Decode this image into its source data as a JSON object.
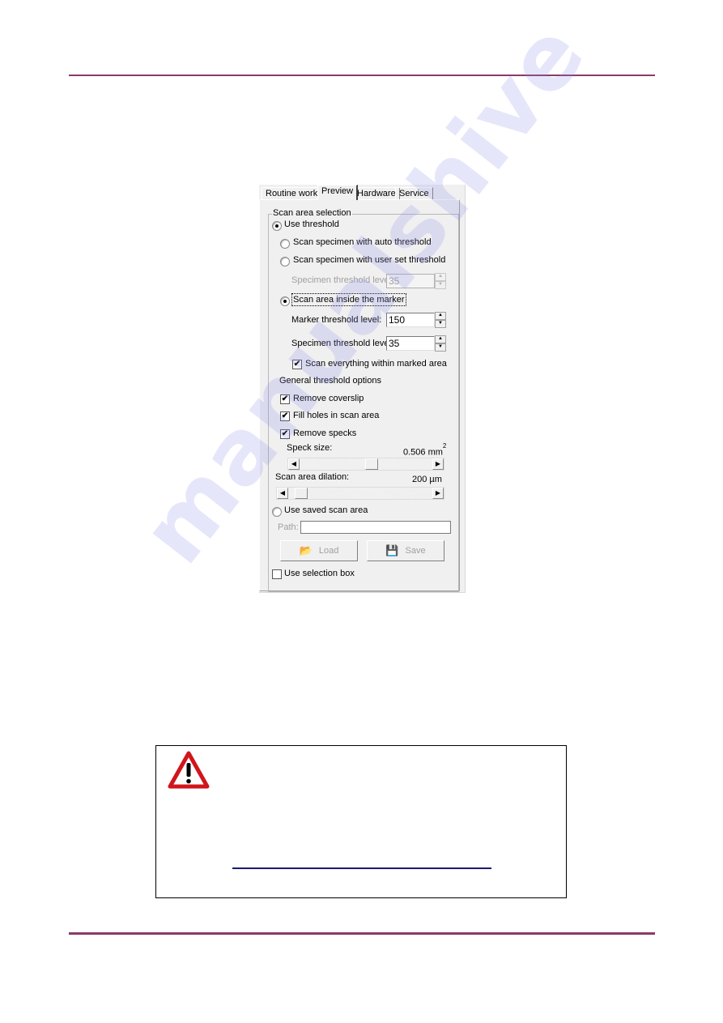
{
  "page": {
    "header_rule_color": "#8a3a68",
    "footer_rule_color": "#8a3a68",
    "watermark": "manualshive"
  },
  "panel": {
    "tabs": [
      {
        "label": "Routine work",
        "active": false
      },
      {
        "label": "Preview",
        "active": true
      },
      {
        "label": "Hardware",
        "active": false
      },
      {
        "label": "Service",
        "active": false
      }
    ],
    "group_title": "Scan area selection",
    "use_threshold": {
      "label": "Use threshold",
      "selected": true
    },
    "auto_threshold": {
      "label": "Scan specimen with auto threshold",
      "selected": false
    },
    "user_threshold": {
      "label": "Scan specimen with user set threshold",
      "selected": false
    },
    "user_specimen_threshold": {
      "label": "Specimen threshold level:",
      "value": "35",
      "enabled": false
    },
    "inside_marker": {
      "label": "Scan area inside the marker",
      "selected": true
    },
    "marker_threshold": {
      "label": "Marker threshold level:",
      "value": "150"
    },
    "marker_specimen_threshold": {
      "label": "Specimen threshold level:",
      "value": "35"
    },
    "scan_everything": {
      "label": "Scan everything within marked area",
      "checked": true
    },
    "general_options_label": "General threshold options",
    "remove_coverslip": {
      "label": "Remove coverslip",
      "checked": true
    },
    "fill_holes": {
      "label": "Fill holes in scan area",
      "checked": true
    },
    "remove_specks": {
      "label": "Remove specks",
      "checked": true
    },
    "speck_size": {
      "label": "Speck size:",
      "value": "0.506 mm",
      "superscript": "2",
      "slider_fraction": 0.55
    },
    "scan_area_dilation": {
      "label": "Scan area dilation:",
      "value": "200 µm",
      "slider_fraction": 0.05
    },
    "use_saved": {
      "label": "Use saved scan area",
      "selected": false
    },
    "path": {
      "label": "Path:",
      "value": ""
    },
    "load_button": "Load",
    "save_button": "Save",
    "use_selection_box": {
      "label": "Use selection box",
      "checked": false
    },
    "icons": {
      "radio_on": "",
      "check": "✔",
      "spin_up": "▲",
      "spin_down": "▼",
      "scroll_left": "◀",
      "scroll_right": "▶",
      "load": "📂",
      "save": "💾"
    }
  },
  "warning": {
    "icon": "warning-triangle",
    "icon_color": "#d0161c",
    "link_color": "#1a1a6e"
  }
}
